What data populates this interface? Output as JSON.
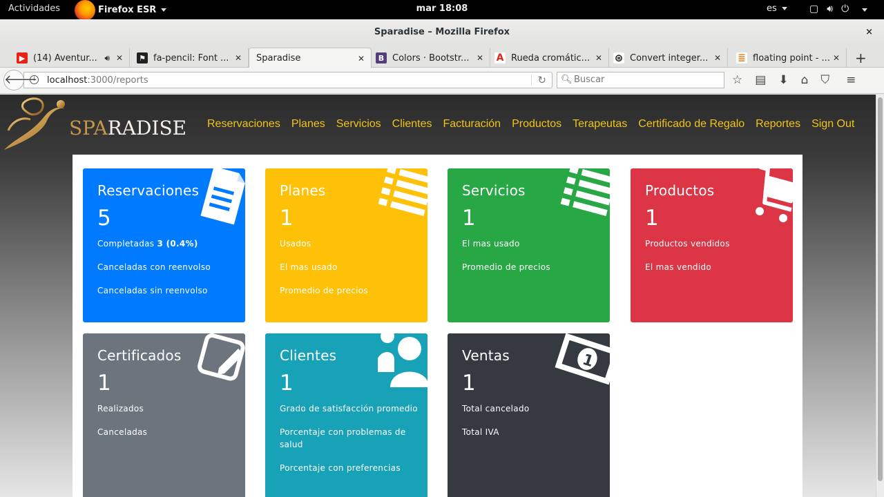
{
  "topbar": {
    "activities": "Actividades",
    "app_name": "Firefox ESR",
    "clock": "mar 18:08",
    "language": "es"
  },
  "window": {
    "title": "Sparadise – Mozilla Firefox",
    "close": "×"
  },
  "tabs": [
    {
      "label": "(14) Aventur...",
      "icon": "youtube-icon",
      "color": "#e62117"
    },
    {
      "label": "fa-pencil: Font ...",
      "icon": "flag-icon",
      "color": "#222222"
    },
    {
      "label": "Sparadise",
      "icon": "",
      "color": ""
    },
    {
      "label": "Colors · Bootstr...",
      "icon": "bootstrap-icon",
      "color": "#563d7c"
    },
    {
      "label": "Rueda cromátic...",
      "icon": "adobe-icon",
      "color": "#e1251b"
    },
    {
      "label": "Convert integer...",
      "icon": "aperture-icon",
      "color": "#222222"
    },
    {
      "label": "floating point - ...",
      "icon": "stackoverflow-icon",
      "color": "#f48024"
    }
  ],
  "navbar": {
    "url_host": "localhost",
    "url_path": ":3000/reports",
    "search_placeholder": "Buscar"
  },
  "site": {
    "logo_spa": "SPA",
    "logo_rest": "RADISE",
    "nav": [
      "Reservaciones",
      "Planes",
      "Servicios",
      "Clientes",
      "Facturación",
      "Productos",
      "Terapeutas",
      "Certificado de Regalo",
      "Reportes",
      "Sign Out"
    ],
    "nav_color": "#f0c419"
  },
  "cards": [
    {
      "title": "Reservaciones",
      "count": "5",
      "color": "#007bff",
      "icon": "document-icon",
      "lines": [
        "Completadas ",
        "Canceladas con reenvolso",
        "Canceladas sin reenvolso"
      ],
      "completed_value": "3 (0.4%)"
    },
    {
      "title": "Planes",
      "count": "1",
      "color": "#ffc107",
      "icon": "list-icon",
      "lines": [
        "Usados",
        "El mas usado",
        "Promedio de precios"
      ]
    },
    {
      "title": "Servicios",
      "count": "1",
      "color": "#28a745",
      "icon": "list-icon",
      "lines": [
        "El mas usado",
        "Promedio de precios"
      ]
    },
    {
      "title": "Productos",
      "count": "1",
      "color": "#dc3545",
      "icon": "shopping-cart-icon",
      "lines": [
        "Productos vendidos",
        "El mas vendido"
      ]
    },
    {
      "title": "Certificados",
      "count": "1",
      "color": "#6c757d",
      "icon": "pencil-square-icon",
      "lines": [
        "Realizados",
        "Canceladas"
      ]
    },
    {
      "title": "Clientes",
      "count": "1",
      "color": "#17a2b8",
      "icon": "users-icon",
      "lines": [
        "Grado de satisfacción promedio",
        "Porcentaje con problemas de salud",
        "Porcentaje con preferencias"
      ]
    },
    {
      "title": "Ventas",
      "count": "1",
      "color": "#343a40",
      "icon": "money-icon",
      "lines": [
        "Total cancelado",
        "Total IVA"
      ]
    }
  ]
}
